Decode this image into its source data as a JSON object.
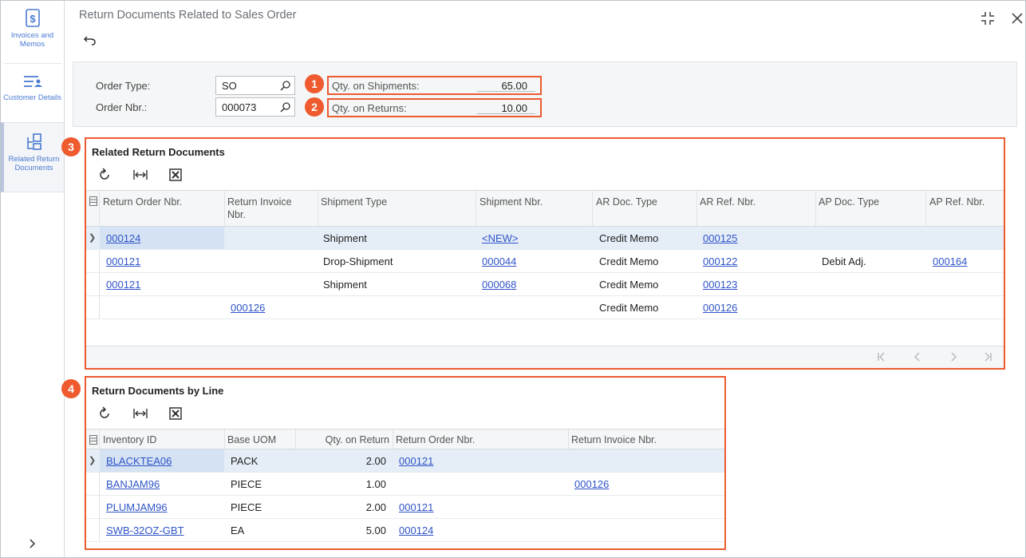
{
  "sidebar": {
    "items": [
      {
        "label": "Invoices and Memos",
        "icon": "invoice-icon"
      },
      {
        "label": "Customer Details",
        "icon": "customer-icon"
      },
      {
        "label": "Related Return Documents",
        "icon": "related-docs-icon"
      }
    ],
    "expand_icon": "chevron-right-icon"
  },
  "header": {
    "title": "Return Documents Related to Sales Order",
    "undo_icon": "undo-icon",
    "collapse_icon": "collapse-icon",
    "close_icon": "close-icon"
  },
  "form": {
    "order_type_label": "Order Type:",
    "order_type_value": "SO",
    "order_nbr_label": "Order Nbr.:",
    "order_nbr_value": "000073",
    "qty_shipments_label": "Qty. on Shipments:",
    "qty_shipments_value": "65.00",
    "qty_returns_label": "Qty. on Returns:",
    "qty_returns_value": "10.00"
  },
  "badges": [
    "1",
    "2",
    "3",
    "4"
  ],
  "related": {
    "title": "Related Return Documents",
    "columns": [
      "Return Order Nbr.",
      "Return Invoice Nbr.",
      "Shipment Type",
      "Shipment Nbr.",
      "AR Doc. Type",
      "AR Ref. Nbr.",
      "AP Doc. Type",
      "AP Ref. Nbr."
    ],
    "rows": [
      [
        "000124",
        "",
        "Shipment",
        "<NEW>",
        "Credit Memo",
        "000125",
        "",
        ""
      ],
      [
        "000121",
        "",
        "Drop-Shipment",
        "000044",
        "Credit Memo",
        "000122",
        "Debit Adj.",
        "000164"
      ],
      [
        "000121",
        "",
        "Shipment",
        "000068",
        "Credit Memo",
        "000123",
        "",
        ""
      ],
      [
        "",
        "000126",
        "",
        "",
        "Credit Memo",
        "000126",
        "",
        ""
      ]
    ]
  },
  "by_line": {
    "title": "Return Documents by Line",
    "columns": [
      "Inventory ID",
      "Base UOM",
      "Qty. on Return",
      "Return Order Nbr.",
      "Return Invoice Nbr."
    ],
    "rows": [
      [
        "BLACKTEA06",
        "PACK",
        "2.00",
        "000121",
        ""
      ],
      [
        "BANJAM96",
        "PIECE",
        "1.00",
        "",
        "000126"
      ],
      [
        "PLUMJAM96",
        "PIECE",
        "2.00",
        "000121",
        ""
      ],
      [
        "SWB-32OZ-GBT",
        "EA",
        "5.00",
        "000124",
        ""
      ]
    ]
  },
  "colors": {
    "accent": "#ec5a30",
    "link": "#2f54c9",
    "sidebar_text": "#4a7bd1"
  }
}
